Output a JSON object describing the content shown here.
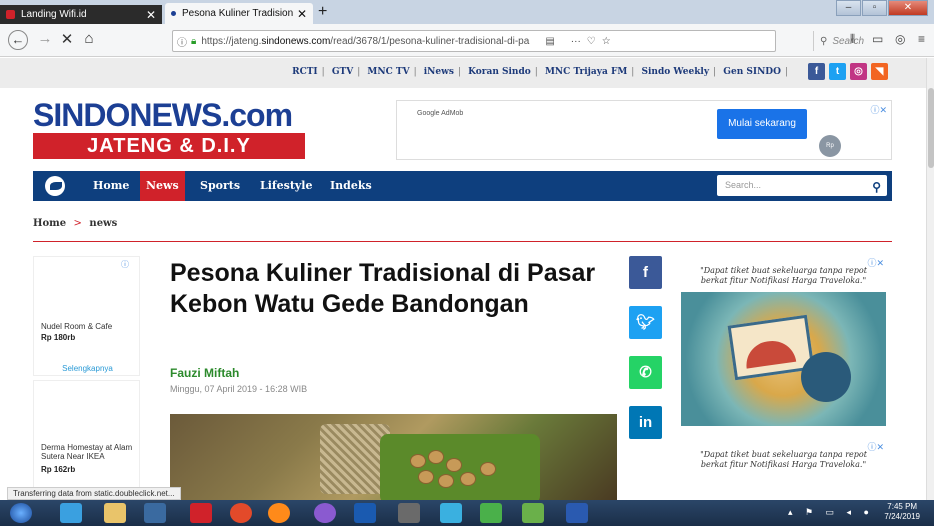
{
  "browser": {
    "tabs": [
      {
        "title": "Landing Wifi.id",
        "active": false
      },
      {
        "title": "Pesona Kuliner Tradisional di P",
        "active": true
      }
    ],
    "url_prefix": "https://jateng.",
    "url_domain": "sindonews.com",
    "url_path": "/read/3678/1/pesona-kuliner-tradisional-di-pa",
    "more_label": "···",
    "search_placeholder": "Search",
    "status_text": "Transferring data from static.doubleclick.net..."
  },
  "site": {
    "partners": [
      "RCTI",
      "GTV",
      "MNC TV",
      "iNews",
      "Koran Sindo",
      "MNC Trijaya FM",
      "Sindo Weekly",
      "Gen SINDO"
    ],
    "logo_main": "SINDONEWS.com",
    "logo_sub": "JATENG & D.I.Y",
    "ad_top": {
      "provider": "Google AdMob",
      "cta": "Mulai sekarang",
      "coin": "Rp"
    },
    "nav": [
      "Home",
      "News",
      "Sports",
      "Lifestyle",
      "Indeks"
    ],
    "nav_active": "News",
    "nav_search_placeholder": "Search...",
    "breadcrumb": [
      "Home",
      "news"
    ],
    "breadcrumb_sep": ">"
  },
  "left_ads": [
    {
      "name": "Nudel Room & Cafe",
      "price": "Rp 180rb",
      "more": "Selengkapnya"
    },
    {
      "name": "Derma Homestay at Alam Sutera Near IKEA",
      "price": "Rp 162rb"
    }
  ],
  "article": {
    "title": "Pesona Kuliner Tradisional di Pasar Kebon Watu Gede Bandongan",
    "author": "Fauzi Miftah",
    "date": "Minggu, 07 April 2019 - 16:28 WIB"
  },
  "share": [
    "f",
    "t",
    "wa",
    "in"
  ],
  "right_ads": [
    {
      "text": "\"Dapat tiket buat sekeluarga tanpa repot berkat fitur Notifikasi Harga Traveloka.\""
    },
    {
      "text": "\"Dapat tiket buat sekeluarga tanpa repot berkat fitur Notifikasi Harga Traveloka.\""
    }
  ],
  "taskbar": {
    "time": "7:45 PM",
    "date": "7/24/2019"
  },
  "colors": {
    "brand_blue": "#0e3f7e",
    "brand_red": "#d0222a",
    "author_green": "#2c8a2c"
  }
}
